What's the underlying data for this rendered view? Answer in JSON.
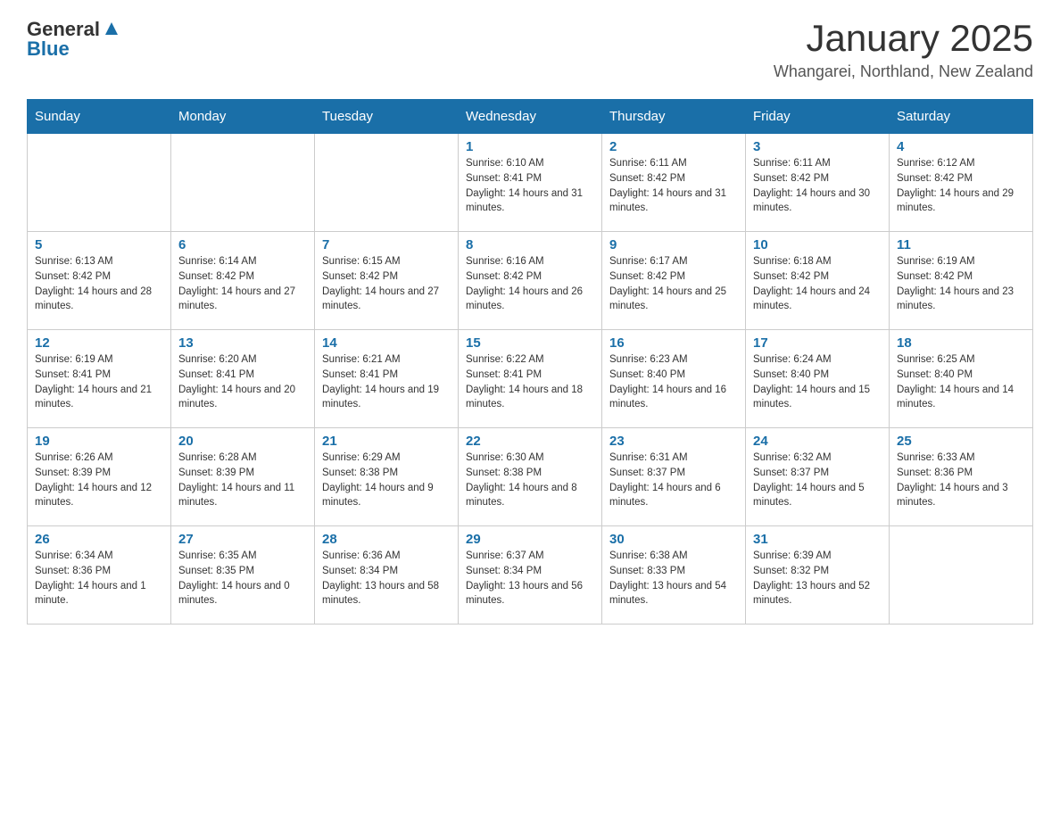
{
  "header": {
    "logo_general": "General",
    "logo_blue": "Blue",
    "title": "January 2025",
    "subtitle": "Whangarei, Northland, New Zealand"
  },
  "weekdays": [
    "Sunday",
    "Monday",
    "Tuesday",
    "Wednesday",
    "Thursday",
    "Friday",
    "Saturday"
  ],
  "weeks": [
    [
      {
        "day": "",
        "info": ""
      },
      {
        "day": "",
        "info": ""
      },
      {
        "day": "",
        "info": ""
      },
      {
        "day": "1",
        "info": "Sunrise: 6:10 AM\nSunset: 8:41 PM\nDaylight: 14 hours and 31 minutes."
      },
      {
        "day": "2",
        "info": "Sunrise: 6:11 AM\nSunset: 8:42 PM\nDaylight: 14 hours and 31 minutes."
      },
      {
        "day": "3",
        "info": "Sunrise: 6:11 AM\nSunset: 8:42 PM\nDaylight: 14 hours and 30 minutes."
      },
      {
        "day": "4",
        "info": "Sunrise: 6:12 AM\nSunset: 8:42 PM\nDaylight: 14 hours and 29 minutes."
      }
    ],
    [
      {
        "day": "5",
        "info": "Sunrise: 6:13 AM\nSunset: 8:42 PM\nDaylight: 14 hours and 28 minutes."
      },
      {
        "day": "6",
        "info": "Sunrise: 6:14 AM\nSunset: 8:42 PM\nDaylight: 14 hours and 27 minutes."
      },
      {
        "day": "7",
        "info": "Sunrise: 6:15 AM\nSunset: 8:42 PM\nDaylight: 14 hours and 27 minutes."
      },
      {
        "day": "8",
        "info": "Sunrise: 6:16 AM\nSunset: 8:42 PM\nDaylight: 14 hours and 26 minutes."
      },
      {
        "day": "9",
        "info": "Sunrise: 6:17 AM\nSunset: 8:42 PM\nDaylight: 14 hours and 25 minutes."
      },
      {
        "day": "10",
        "info": "Sunrise: 6:18 AM\nSunset: 8:42 PM\nDaylight: 14 hours and 24 minutes."
      },
      {
        "day": "11",
        "info": "Sunrise: 6:19 AM\nSunset: 8:42 PM\nDaylight: 14 hours and 23 minutes."
      }
    ],
    [
      {
        "day": "12",
        "info": "Sunrise: 6:19 AM\nSunset: 8:41 PM\nDaylight: 14 hours and 21 minutes."
      },
      {
        "day": "13",
        "info": "Sunrise: 6:20 AM\nSunset: 8:41 PM\nDaylight: 14 hours and 20 minutes."
      },
      {
        "day": "14",
        "info": "Sunrise: 6:21 AM\nSunset: 8:41 PM\nDaylight: 14 hours and 19 minutes."
      },
      {
        "day": "15",
        "info": "Sunrise: 6:22 AM\nSunset: 8:41 PM\nDaylight: 14 hours and 18 minutes."
      },
      {
        "day": "16",
        "info": "Sunrise: 6:23 AM\nSunset: 8:40 PM\nDaylight: 14 hours and 16 minutes."
      },
      {
        "day": "17",
        "info": "Sunrise: 6:24 AM\nSunset: 8:40 PM\nDaylight: 14 hours and 15 minutes."
      },
      {
        "day": "18",
        "info": "Sunrise: 6:25 AM\nSunset: 8:40 PM\nDaylight: 14 hours and 14 minutes."
      }
    ],
    [
      {
        "day": "19",
        "info": "Sunrise: 6:26 AM\nSunset: 8:39 PM\nDaylight: 14 hours and 12 minutes."
      },
      {
        "day": "20",
        "info": "Sunrise: 6:28 AM\nSunset: 8:39 PM\nDaylight: 14 hours and 11 minutes."
      },
      {
        "day": "21",
        "info": "Sunrise: 6:29 AM\nSunset: 8:38 PM\nDaylight: 14 hours and 9 minutes."
      },
      {
        "day": "22",
        "info": "Sunrise: 6:30 AM\nSunset: 8:38 PM\nDaylight: 14 hours and 8 minutes."
      },
      {
        "day": "23",
        "info": "Sunrise: 6:31 AM\nSunset: 8:37 PM\nDaylight: 14 hours and 6 minutes."
      },
      {
        "day": "24",
        "info": "Sunrise: 6:32 AM\nSunset: 8:37 PM\nDaylight: 14 hours and 5 minutes."
      },
      {
        "day": "25",
        "info": "Sunrise: 6:33 AM\nSunset: 8:36 PM\nDaylight: 14 hours and 3 minutes."
      }
    ],
    [
      {
        "day": "26",
        "info": "Sunrise: 6:34 AM\nSunset: 8:36 PM\nDaylight: 14 hours and 1 minute."
      },
      {
        "day": "27",
        "info": "Sunrise: 6:35 AM\nSunset: 8:35 PM\nDaylight: 14 hours and 0 minutes."
      },
      {
        "day": "28",
        "info": "Sunrise: 6:36 AM\nSunset: 8:34 PM\nDaylight: 13 hours and 58 minutes."
      },
      {
        "day": "29",
        "info": "Sunrise: 6:37 AM\nSunset: 8:34 PM\nDaylight: 13 hours and 56 minutes."
      },
      {
        "day": "30",
        "info": "Sunrise: 6:38 AM\nSunset: 8:33 PM\nDaylight: 13 hours and 54 minutes."
      },
      {
        "day": "31",
        "info": "Sunrise: 6:39 AM\nSunset: 8:32 PM\nDaylight: 13 hours and 52 minutes."
      },
      {
        "day": "",
        "info": ""
      }
    ]
  ]
}
